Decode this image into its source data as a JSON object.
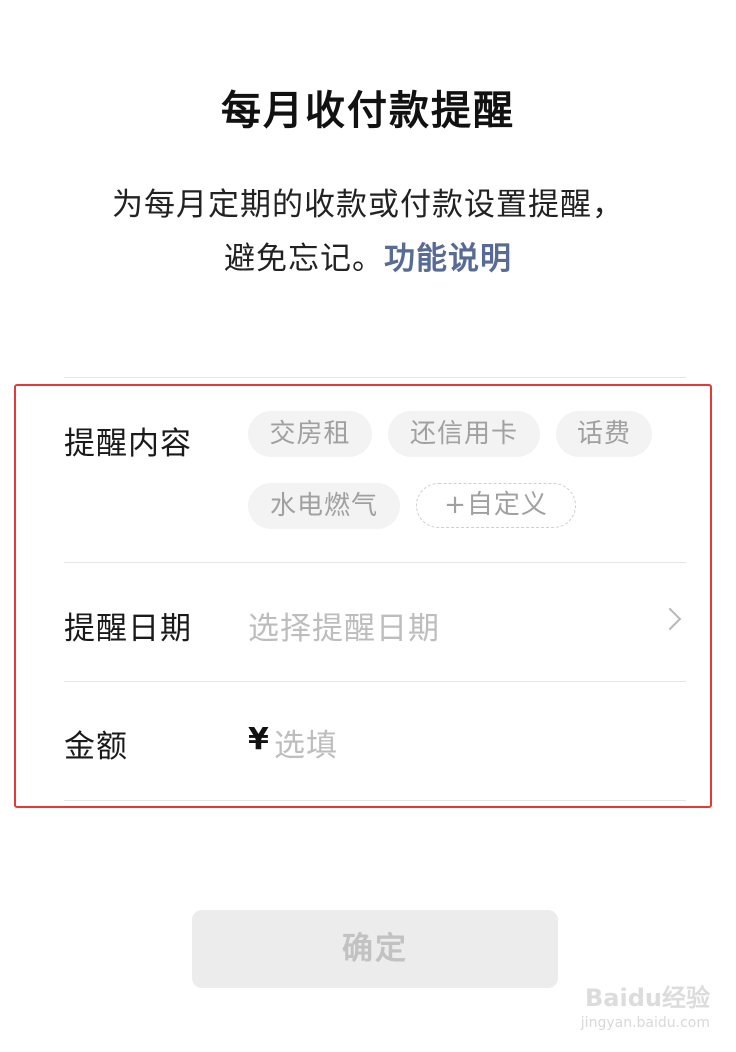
{
  "header": {
    "title": "每月收付款提醒",
    "description_line1": "为每月定期的收款或付款设置提醒，",
    "description_line2": "避免忘记。",
    "help_link": "功能说明"
  },
  "form": {
    "content": {
      "label": "提醒内容",
      "chips": [
        "交房租",
        "还信用卡",
        "话费",
        "水电燃气"
      ],
      "custom_chip": "+自定义"
    },
    "date": {
      "label": "提醒日期",
      "placeholder": "选择提醒日期",
      "chevron_icon": "chevron-right-icon"
    },
    "amount": {
      "label": "金额",
      "currency_symbol": "¥",
      "placeholder": "选填"
    }
  },
  "confirm_button": {
    "label": "确定"
  },
  "watermark": {
    "text": "Baidu经验",
    "sub": "jingyan.baidu.com"
  },
  "colors": {
    "link": "#576b95",
    "highlight_border": "#e53935",
    "button_disabled_bg": "#ececec"
  }
}
